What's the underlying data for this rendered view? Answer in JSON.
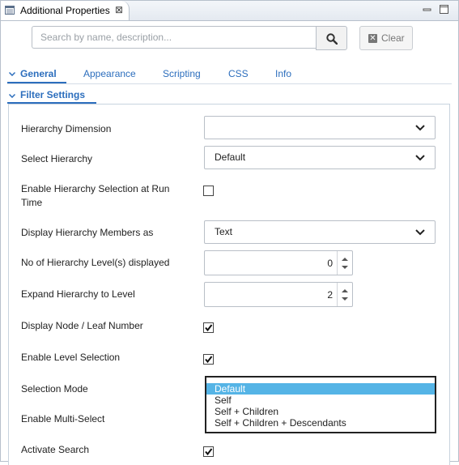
{
  "window": {
    "title": "Additional Properties",
    "close_glyph": "⊠"
  },
  "search": {
    "placeholder": "Search by name, description...",
    "value": "",
    "clear_label": "Clear"
  },
  "tabs": [
    {
      "label": "General",
      "active": true
    },
    {
      "label": "Appearance",
      "active": false
    },
    {
      "label": "Scripting",
      "active": false
    },
    {
      "label": "CSS",
      "active": false
    },
    {
      "label": "Info",
      "active": false
    }
  ],
  "section": {
    "title": "Filter Settings"
  },
  "fields": {
    "hierarchy_dimension": {
      "label": "Hierarchy Dimension",
      "value": ""
    },
    "select_hierarchy": {
      "label": "Select Hierarchy",
      "value": "Default"
    },
    "enable_hierarchy_selection": {
      "label": "Enable Hierarchy Selection at Run Time",
      "checked": false
    },
    "display_members_as": {
      "label": "Display Hierarchy Members as",
      "value": "Text"
    },
    "levels_displayed": {
      "label": "No of Hierarchy Level(s) displayed",
      "value": "0"
    },
    "expand_to_level": {
      "label": "Expand Hierarchy to Level",
      "value": "2"
    },
    "display_node_leaf": {
      "label": "Display Node / Leaf Number",
      "checked": true
    },
    "enable_level_selection": {
      "label": "Enable Level Selection",
      "checked": true
    },
    "selection_mode": {
      "label": "Selection Mode",
      "options": [
        "Default",
        "Self",
        "Self + Children",
        "Self + Children + Descendants"
      ],
      "selected": "Default"
    },
    "enable_multi_select": {
      "label": "Enable Multi-Select"
    },
    "activate_search": {
      "label": "Activate Search",
      "checked": true
    }
  },
  "colors": {
    "accent": "#2c6ebd",
    "selection": "#55b4e6"
  }
}
